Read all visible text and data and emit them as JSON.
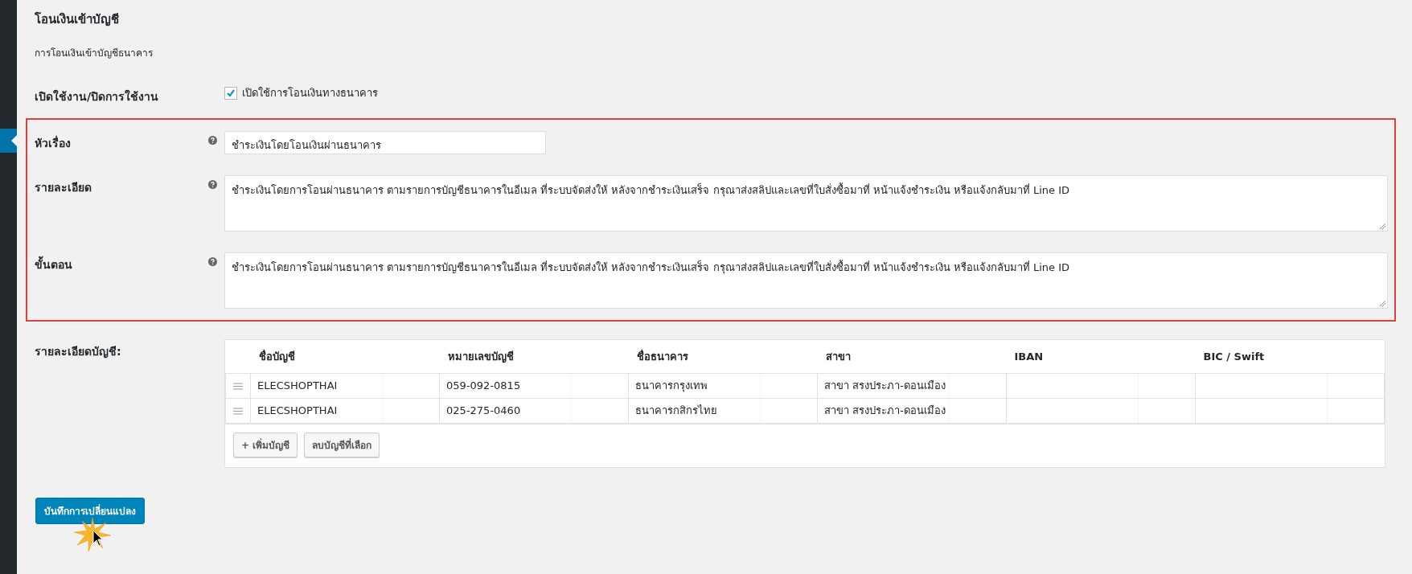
{
  "section": {
    "title": "โอนเงินเข้าบัญชี",
    "description": "การโอนเงินเข้าบัญชีธนาคาร"
  },
  "fields": [
    {
      "kind": "checkbox",
      "label": "เปิดใช้งาน/ปิดการใช้งาน",
      "checkbox_label": "เปิดใช้การโอนเงินทางธนาคาร",
      "checked": true,
      "highlighted": false
    },
    {
      "kind": "text",
      "label": "หัวเรื่อง",
      "value": "ชำระเงินโดยโอนเงินผ่านธนาคาร",
      "highlighted": true
    },
    {
      "kind": "textarea",
      "label": "รายละเอียด",
      "value": "ชำระเงินโดยการโอนผ่านธนาคาร ตามรายการบัญชีธนาคารในอีเมล ที่ระบบจัดส่งให้ หลังจากชำระเงินเสร็จ กรุณาส่งสลิปและเลขที่ใบสั่งซื้อมาที่ หน้าแจ้งชำระเงิน หรือแจ้งกลับมาที่ Line ID",
      "highlighted": true
    },
    {
      "kind": "textarea",
      "label": "ขั้นตอน",
      "value": "ชำระเงินโดยการโอนผ่านธนาคาร ตามรายการบัญชีธนาคารในอีเมล ที่ระบบจัดส่งให้ หลังจากชำระเงินเสร็จ กรุณาส่งสลิปและเลขที่ใบสั่งซื้อมาที่ หน้าแจ้งชำระเงิน หรือแจ้งกลับมาที่ Line ID",
      "highlighted": true
    }
  ],
  "accounts": {
    "label": "รายละเอียดบัญชี:",
    "columns": [
      "ชื่อบัญชี",
      "หมายเลขบัญชี",
      "ชื่อธนาคาร",
      "สาขา",
      "IBAN",
      "BIC / Swift"
    ],
    "rows": [
      {
        "cells": [
          "ELECSHOPTHAI",
          "059-092-0815",
          "ธนาคารกรุงเทพ",
          "สาขา สรงประภา-ดอนเมือง"
        ]
      },
      {
        "cells": [
          "ELECSHOPTHAI",
          "025-275-0460",
          "ธนาคารกสิกรไทย",
          "สาขา สรงประภา-ดอนเมือง"
        ]
      }
    ],
    "buttons": [
      "+ เพิ่มบัญชี",
      "ลบบัญชีที่เลือก"
    ]
  },
  "save_button": "บันทึกการเปลี่ยนแปลง"
}
